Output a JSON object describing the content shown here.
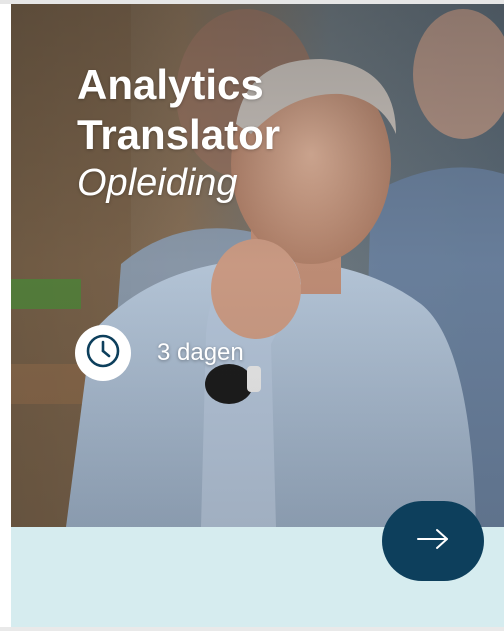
{
  "card": {
    "title_line1": "Analytics",
    "title_line2": "Translator",
    "subtitle": "Opleiding",
    "duration": "3 dagen",
    "duration_icon": "clock-icon",
    "cta_icon": "arrow-right-icon"
  },
  "colors": {
    "card_background": "#d6ecef",
    "cta_background": "#0d3f5c",
    "icon_primary": "#0d3f5c",
    "text_on_photo": "#ffffff"
  }
}
